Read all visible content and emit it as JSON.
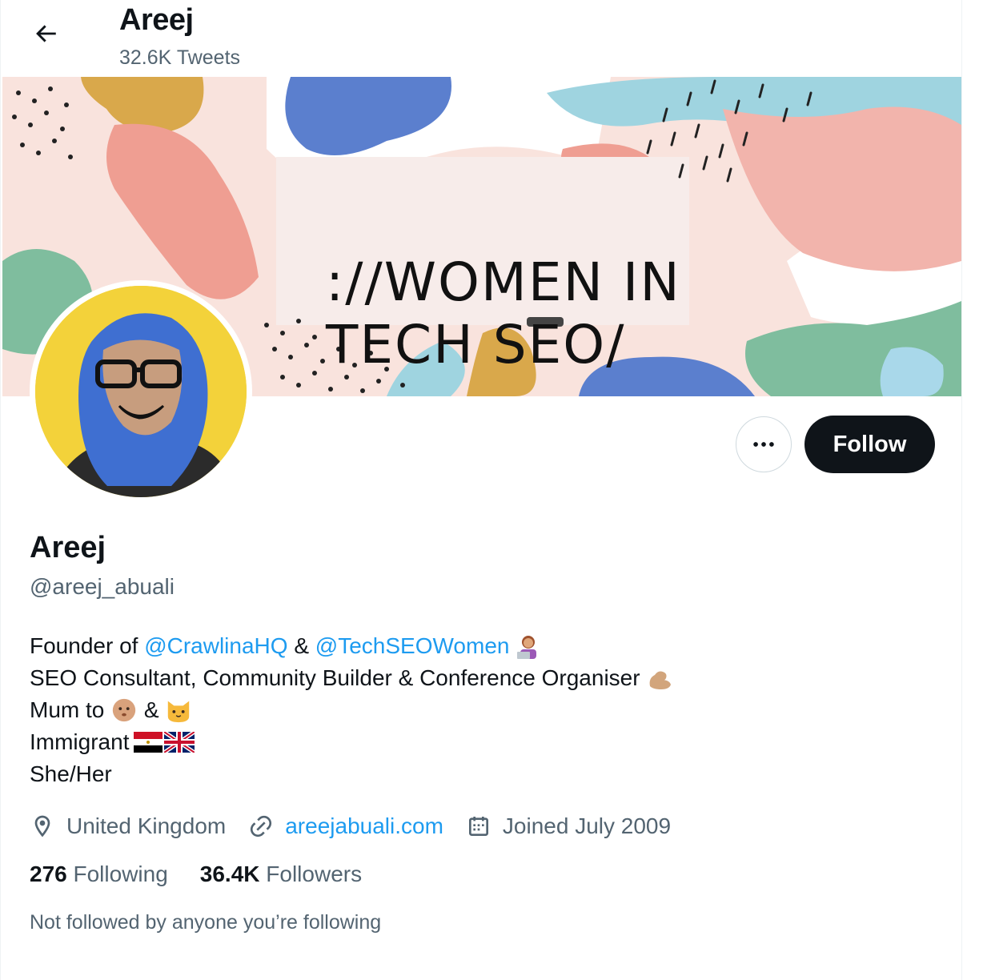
{
  "header": {
    "name": "Areej",
    "tweet_count": "32.6K Tweets"
  },
  "banner": {
    "line1": "://WOMEN IN",
    "line2": "TECH SEO/"
  },
  "actions": {
    "more_icon": "ellipsis-icon",
    "follow_label": "Follow"
  },
  "profile": {
    "name": "Areej",
    "handle": "@areej_abuali"
  },
  "bio": {
    "line1_prefix": "Founder of ",
    "mention1": "@CrawlinaHQ",
    "amp": " & ",
    "mention2": "@TechSEOWomen",
    "line2": "SEO Consultant, Community Builder & Conference Organiser",
    "line3_prefix": "Mum to ",
    "line3_amp": " & ",
    "line4": "Immigrant",
    "line5": "She/Her"
  },
  "meta": {
    "location": "United Kingdom",
    "website": "areejabuali.com",
    "joined": "Joined July 2009"
  },
  "stats": {
    "following_count": "276",
    "following_label": "Following",
    "followers_count": "36.4K",
    "followers_label": "Followers"
  },
  "not_followed_text": "Not followed by anyone you’re following",
  "colors": {
    "link": "#1d9bf0",
    "secondary": "#536471",
    "primary": "#0f1419"
  }
}
